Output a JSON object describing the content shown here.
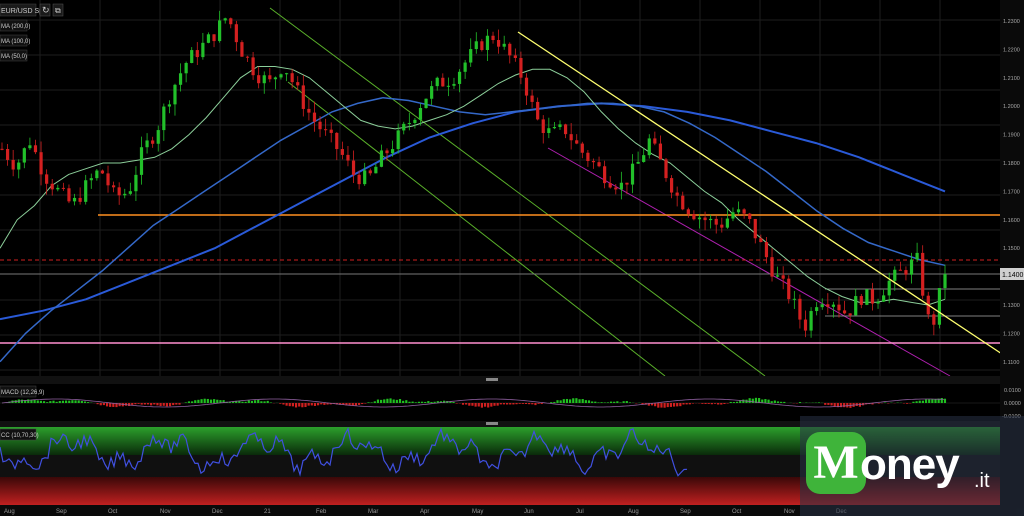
{
  "toolbar": {
    "symbol": "EUR/USD Spot",
    "refresh_icon": "refresh-icon",
    "popout_icon": "popout-icon"
  },
  "legend": {
    "ma200": "MA (200,0)",
    "ma100": "MA (100,0)",
    "ma50": "MA (50,0)"
  },
  "price_axis": {
    "labels": [
      "1.2300",
      "1.2200",
      "1.2100",
      "1.2000",
      "1.1900",
      "1.1800",
      "1.1700",
      "1.1600",
      "1.1500",
      "1.1300",
      "1.1200",
      "1.1100"
    ],
    "current_price": "1.1400"
  },
  "macd": {
    "label": "MACD (12,26,9)",
    "axis": [
      "0.0100",
      "0.0000",
      "-0.0100"
    ]
  },
  "osc": {
    "label": "CC (10,70,30)"
  },
  "time_axis": {
    "labels": [
      "Aug",
      "Sep",
      "Oct",
      "Nov",
      "Dec",
      "21",
      "Feb",
      "Mar",
      "Apr",
      "May",
      "Jun",
      "Jul",
      "Aug",
      "Sep",
      "Oct",
      "Nov",
      "Dec"
    ]
  },
  "colors": {
    "bull": "#22c02a",
    "bear": "#d42020",
    "ma50": "#8ccf9a",
    "ma100": "#2060c8",
    "ma200": "#2a5ad8",
    "support_orange": "#ff9020",
    "support_pink": "#ff90d0",
    "resistance_red": "#d02020",
    "trend_yellow": "#ffff70",
    "channel_green": "#5ab02a",
    "channel_purple": "#b020b0"
  },
  "chart_data": {
    "type": "line",
    "title": "EUR/USD Spot",
    "ylim": [
      1.105,
      1.236
    ],
    "price_points": [
      1.185,
      1.179,
      1.188,
      1.176,
      1.17,
      1.165,
      1.172,
      1.178,
      1.168,
      1.17,
      1.184,
      1.192,
      1.205,
      1.215,
      1.22,
      1.225,
      1.232,
      1.22,
      1.212,
      1.208,
      1.215,
      1.205,
      1.196,
      1.19,
      1.184,
      1.176,
      1.174,
      1.182,
      1.188,
      1.195,
      1.203,
      1.208,
      1.21,
      1.216,
      1.222,
      1.225,
      1.218,
      1.21,
      1.195,
      1.19,
      1.192,
      1.185,
      1.18,
      1.175,
      1.172,
      1.178,
      1.188,
      1.178,
      1.168,
      1.163,
      1.16,
      1.158,
      1.163,
      1.16,
      1.15,
      1.14,
      1.133,
      1.122,
      1.133,
      1.132,
      1.127,
      1.133,
      1.132,
      1.138,
      1.142,
      1.146,
      1.12,
      1.142
    ],
    "ma50_points": [
      1.15,
      1.16,
      1.165,
      1.172,
      1.176,
      1.178,
      1.18,
      1.18,
      1.181,
      1.182,
      1.185,
      1.19,
      1.196,
      1.203,
      1.21,
      1.214,
      1.214,
      1.213,
      1.21,
      1.205,
      1.2,
      1.195,
      1.193,
      1.192,
      1.193,
      1.195,
      1.197,
      1.2,
      1.204,
      1.208,
      1.211,
      1.213,
      1.213,
      1.21,
      1.205,
      1.198,
      1.192,
      1.187,
      1.183,
      1.18,
      1.175,
      1.17,
      1.166,
      1.16,
      1.155,
      1.15,
      1.145,
      1.14,
      1.136,
      1.133,
      1.131,
      1.131,
      1.132,
      1.131,
      1.13,
      1.132
    ],
    "ma100_points": [
      1.11,
      1.12,
      1.128,
      1.135,
      1.142,
      1.15,
      1.158,
      1.164,
      1.17,
      1.176,
      1.182,
      1.188,
      1.193,
      1.198,
      1.201,
      1.203,
      1.202,
      1.2,
      1.198,
      1.197,
      1.198,
      1.199,
      1.2,
      1.201,
      1.201,
      1.2,
      1.198,
      1.194,
      1.189,
      1.183,
      1.177,
      1.17,
      1.163,
      1.157,
      1.152,
      1.149,
      1.146,
      1.144
    ],
    "ma200_points": [
      1.125,
      1.128,
      1.132,
      1.138,
      1.144,
      1.15,
      1.158,
      1.166,
      1.174,
      1.182,
      1.189,
      1.194,
      1.198,
      1.2,
      1.201,
      1.2,
      1.198,
      1.195,
      1.191,
      1.187,
      1.182,
      1.176,
      1.17
    ],
    "support_levels": [
      1.1612,
      1.14,
      1.117
    ],
    "resistance_level": 1.1467
  }
}
